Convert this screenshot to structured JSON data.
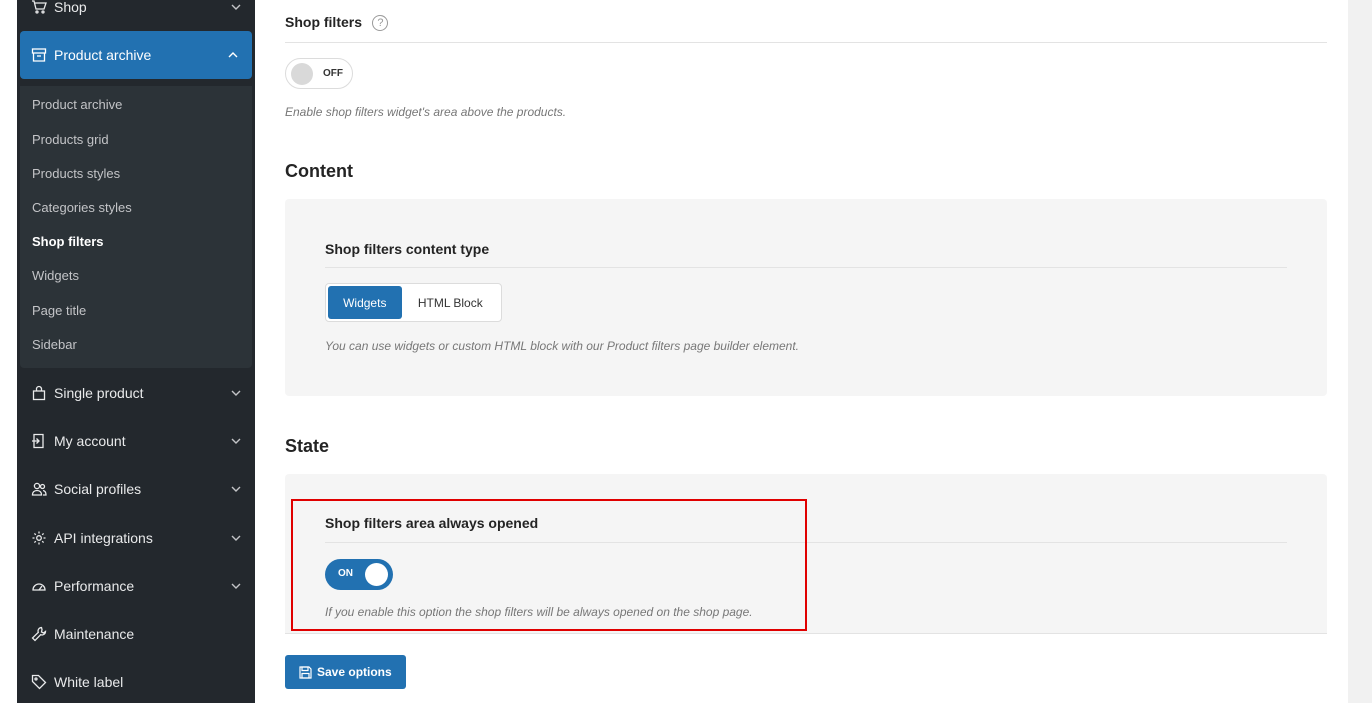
{
  "sidebar": {
    "items": [
      {
        "label": "Shop",
        "icon": "cart-icon"
      },
      {
        "label": "Product archive",
        "icon": "archive-icon"
      },
      {
        "label": "Single product",
        "icon": "bag-icon"
      },
      {
        "label": "My account",
        "icon": "login-icon"
      },
      {
        "label": "Social profiles",
        "icon": "users-icon"
      },
      {
        "label": "API integrations",
        "icon": "gear-icon"
      },
      {
        "label": "Performance",
        "icon": "speedometer-icon"
      },
      {
        "label": "Maintenance",
        "icon": "wrench-icon"
      },
      {
        "label": "White label",
        "icon": "tag-icon"
      }
    ],
    "sub_items": [
      {
        "label": "Product archive"
      },
      {
        "label": "Products grid"
      },
      {
        "label": "Products styles"
      },
      {
        "label": "Categories styles"
      },
      {
        "label": "Shop filters"
      },
      {
        "label": "Widgets"
      },
      {
        "label": "Page title"
      },
      {
        "label": "Sidebar"
      }
    ]
  },
  "shop_filters": {
    "title": "Shop filters",
    "help": "?",
    "toggle_state": "OFF",
    "description": "Enable shop filters widget's area above the products."
  },
  "content": {
    "title": "Content",
    "field_title": "Shop filters content type",
    "options": [
      "Widgets",
      "HTML Block"
    ],
    "selected": "Widgets",
    "description": "You can use widgets or custom HTML block with our Product filters page builder element."
  },
  "state": {
    "title": "State",
    "field_title": "Shop filters area always opened",
    "toggle_state": "ON",
    "description": "If you enable this option the shop filters will be always opened on the shop page."
  },
  "save_label": "Save options",
  "colors": {
    "accent": "#2271b1",
    "sidebar_bg": "#23282d",
    "highlight": "#e00000"
  }
}
